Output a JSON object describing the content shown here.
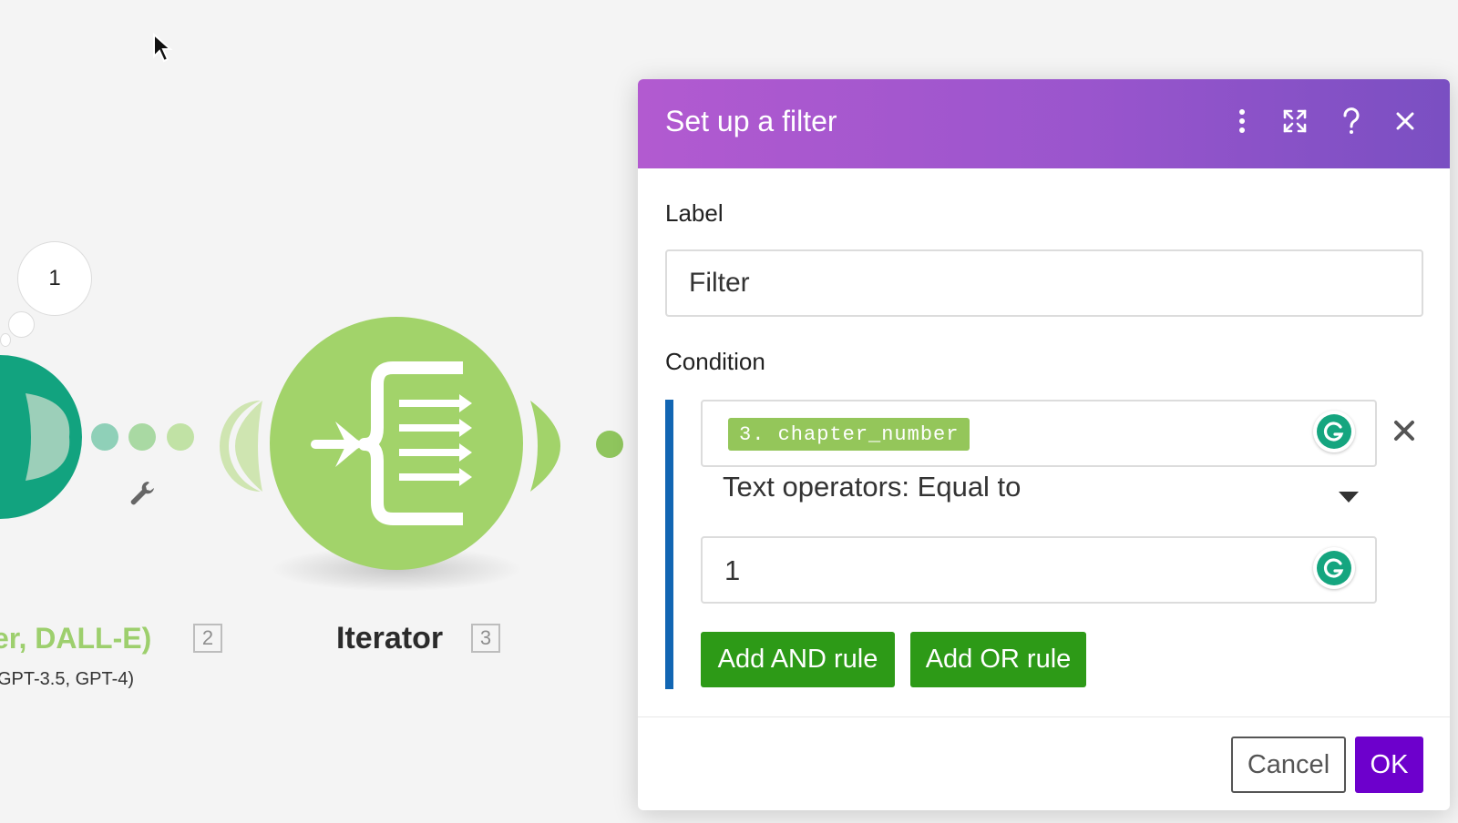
{
  "canvas": {
    "bubble_count": "1",
    "left_module": {
      "title_fragment": "er, DALL-E)",
      "subtitle_fragment": "GPT-3.5, GPT-4)",
      "number": "2"
    },
    "iterator_module": {
      "title": "Iterator",
      "number": "3"
    },
    "colors": {
      "openai_green": "#12a37f",
      "iterator_green": "#a2d36a",
      "filter_dots": "#8fd0b8"
    }
  },
  "dialog": {
    "title": "Set up a filter",
    "header_icons": [
      "more-vertical-icon",
      "expand-icon",
      "help-icon",
      "close-icon"
    ],
    "label_heading": "Label",
    "label_value": "Filter",
    "condition_heading": "Condition",
    "condition": {
      "field_pill": "3. chapter_number",
      "operator": "Text operators: Equal to",
      "value": "1"
    },
    "add_and_label": "Add AND rule",
    "add_or_label": "Add OR rule",
    "cancel_label": "Cancel",
    "ok_label": "OK",
    "colors": {
      "header_start": "#b25ad0",
      "header_end": "#7a4fc2",
      "condition_bar": "#1266b3",
      "rule_button": "#2d9a17",
      "ok_button": "#6d00cc"
    }
  }
}
